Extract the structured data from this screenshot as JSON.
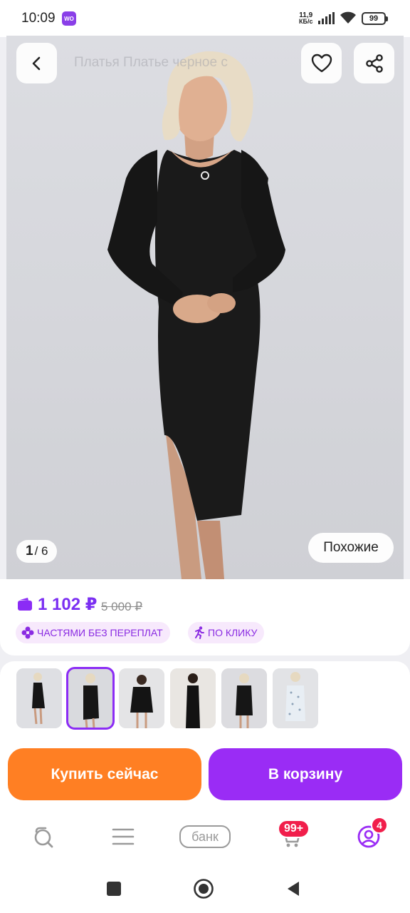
{
  "status_bar": {
    "time": "10:09",
    "app_icon_text": "WO",
    "network_speed_value": "11,9",
    "network_speed_unit": "КБ/с",
    "battery": "99"
  },
  "product": {
    "faded_title": "Платья Платье черное с",
    "image_counter_current": "1",
    "image_counter_total": "/ 6",
    "similar_label": "Похожие",
    "price_current": "1 102 ₽",
    "price_old": "5 000 ₽",
    "badges": [
      {
        "label": "ЧАСТЯМИ БЕЗ ПЕРЕПЛАТ",
        "icon": "installments-icon"
      },
      {
        "label": "ПО КЛИКУ",
        "icon": "running-person-icon"
      }
    ],
    "thumbnails_count": 6,
    "active_thumbnail": 2
  },
  "actions": {
    "buy_now": "Купить сейчас",
    "add_to_cart": "В корзину"
  },
  "bottom_nav": {
    "bank_label": "банк",
    "cart_badge": "99+",
    "profile_badge": "4"
  },
  "colors": {
    "accent_purple": "#9a2cf5",
    "buy_orange": "#ff7f23",
    "badge_red": "#f11e4b"
  }
}
